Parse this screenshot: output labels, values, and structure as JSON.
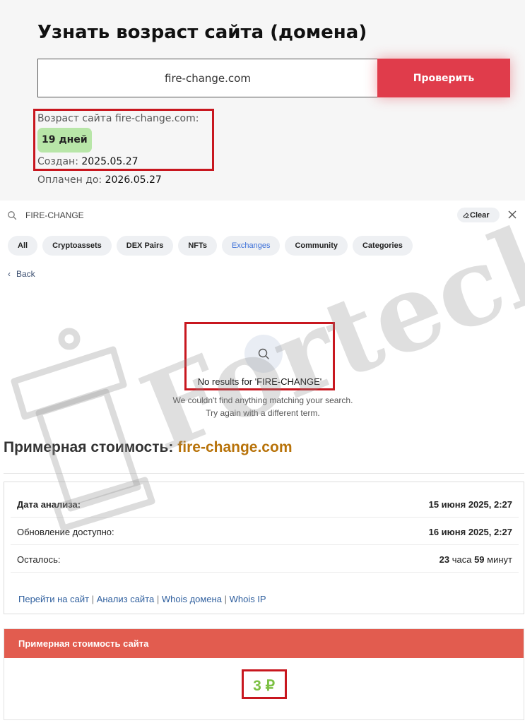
{
  "age": {
    "title": "Узнать возраст сайта (домена)",
    "input_value": "fire-change.com",
    "check_label": "Проверить",
    "age_label": "Возраст сайта fire-change.com:",
    "age_days": "19 дней",
    "created_label": "Создан:",
    "created_value": "2025.05.27",
    "paid_label": "Оплачен до:",
    "paid_value": "2026.05.27"
  },
  "search": {
    "query": "FIRE-CHANGE",
    "clear_label": "Clear",
    "tabs": [
      "All",
      "Cryptoassets",
      "DEX Pairs",
      "NFTs",
      "Exchanges",
      "Community",
      "Categories"
    ],
    "active_tab": "Exchanges",
    "back_label": "Back",
    "no_results_title": "No results for 'FIRE-CHANGE'",
    "no_results_line1": "We couldn't find anything matching your search.",
    "no_results_line2": "Try again with a different term."
  },
  "valuation": {
    "title_prefix": "Примерная стоимость:",
    "title_domain": "fire-change.com",
    "analysis_date_label": "Дата анализа:",
    "analysis_date_value": "15 июня 2025, 2:27",
    "update_label": "Обновление доступно:",
    "update_value": "16 июня 2025, 2:27",
    "remaining_label": "Осталось:",
    "remaining_hours": "23",
    "remaining_hours_unit": "часа",
    "remaining_minutes": "59",
    "remaining_minutes_unit": "минут",
    "links": [
      "Перейти на сайт",
      "Анализ сайта",
      "Whois домена",
      "Whois IP"
    ],
    "price_header": "Примерная стоимость сайта",
    "price_value": "3 ₽"
  },
  "watermark_text": "Forteck",
  "colors": {
    "check_button": "#e03c4b",
    "highlight_border": "#c8171f",
    "age_badge": "#b8e6a8",
    "price_header": "#e25c4f",
    "price_value": "#7cc043",
    "title_domain": "#b8730a",
    "link": "#2f5f9e",
    "active_tab": "#3b6fd8"
  }
}
